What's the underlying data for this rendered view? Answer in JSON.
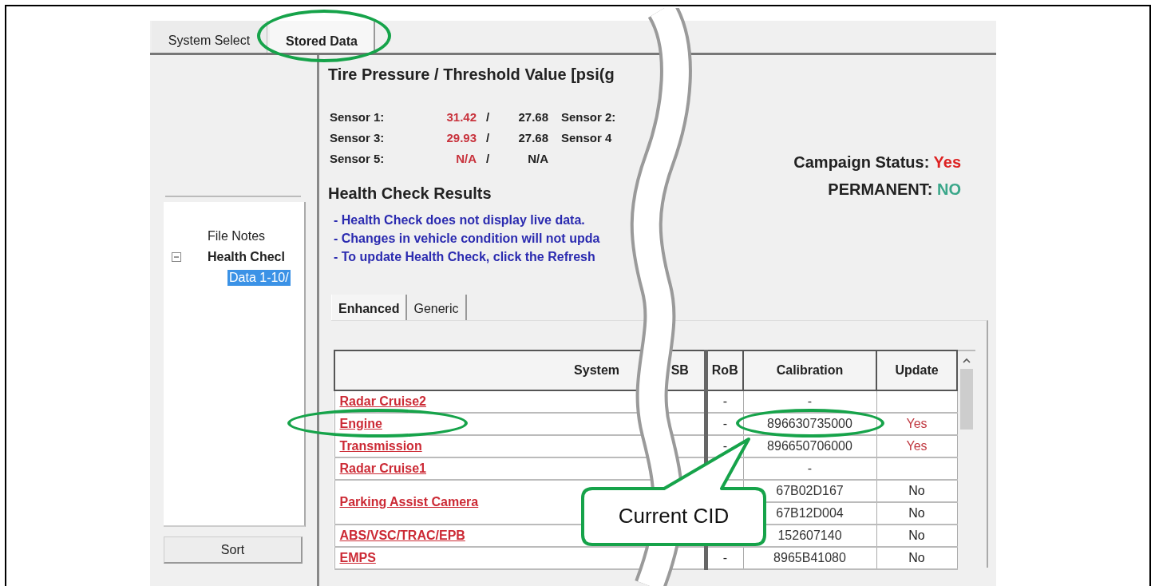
{
  "tabs": [
    {
      "label": "System Select",
      "selected": false
    },
    {
      "label": "Stored Data",
      "selected": true
    }
  ],
  "tree": [
    {
      "label": "File Notes",
      "selected": false
    },
    {
      "label": "Health Checl",
      "selected": false,
      "expanded": true,
      "children": [
        {
          "label": "Data 1-10/",
          "selected": true
        }
      ]
    }
  ],
  "sort_button": "Sort",
  "pressure": {
    "title": "Tire Pressure / Threshold Value [psi(g",
    "sensors": [
      {
        "label": "Sensor 1:",
        "value": "31.42",
        "slash": "/",
        "threshold": "27.68",
        "column_5": "Sensor 2:"
      },
      {
        "label": "Sensor 3:",
        "value": "29.93",
        "slash": "/",
        "threshold": "27.68",
        "column_5": "Sensor 4"
      },
      {
        "label": "Sensor 5:",
        "value": "N/A",
        "slash": "/",
        "threshold": "N/A"
      }
    ]
  },
  "campaign_status": {
    "label": "Campaign Status:",
    "value": "Yes"
  },
  "permanent": {
    "label": "PERMANENT:",
    "value": "NO"
  },
  "health_check": {
    "title": "Health Check Results",
    "notes": [
      "- Health Check does not display live data.",
      "- Changes in vehicle condition will not upda",
      "- To update Health Check, click the Refresh"
    ]
  },
  "subtabs": [
    {
      "label": "Enhanced",
      "selected": true
    },
    {
      "label": "Generic",
      "selected": false
    }
  ],
  "table": {
    "columns": [
      "System",
      "SB",
      "RoB",
      "Calibration",
      "Update"
    ],
    "rows": [
      {
        "system": "Radar Cruise2",
        "rob": "-",
        "entries": [
          {
            "calibration": "-"
          }
        ]
      },
      {
        "system": "Engine",
        "rob": "-",
        "entries": [
          {
            "calibration": "896630735000",
            "update": "Yes",
            "flagged": true
          }
        ]
      },
      {
        "system": "Transmission",
        "rob": "-",
        "entries": [
          {
            "calibration": "896650706000",
            "update": "Yes",
            "flagged": true
          }
        ]
      },
      {
        "system": "Radar Cruise1",
        "entries": [
          {
            "calibration": "-"
          }
        ]
      },
      {
        "system": "Parking Assist Camera",
        "entries": [
          {
            "calibration": "67B02D167",
            "update": "No",
            "flagged": false
          },
          {
            "calibration": "67B12D004",
            "update": "No",
            "flagged": false
          }
        ]
      },
      {
        "system": "ABS/VSC/TRAC/EPB",
        "entries": [
          {
            "calibration": "152607140",
            "update": "No",
            "flagged": false
          }
        ]
      },
      {
        "system": "EMPS",
        "rob": "-",
        "entries": [
          {
            "calibration": "8965B41080",
            "update": "No",
            "flagged": false
          }
        ]
      }
    ]
  },
  "annotations": [
    {
      "kind": "ellipse"
    },
    {
      "kind": "ellipse"
    },
    {
      "kind": "ellipse"
    },
    {
      "kind": "callout",
      "text": "Current CID"
    }
  ]
}
